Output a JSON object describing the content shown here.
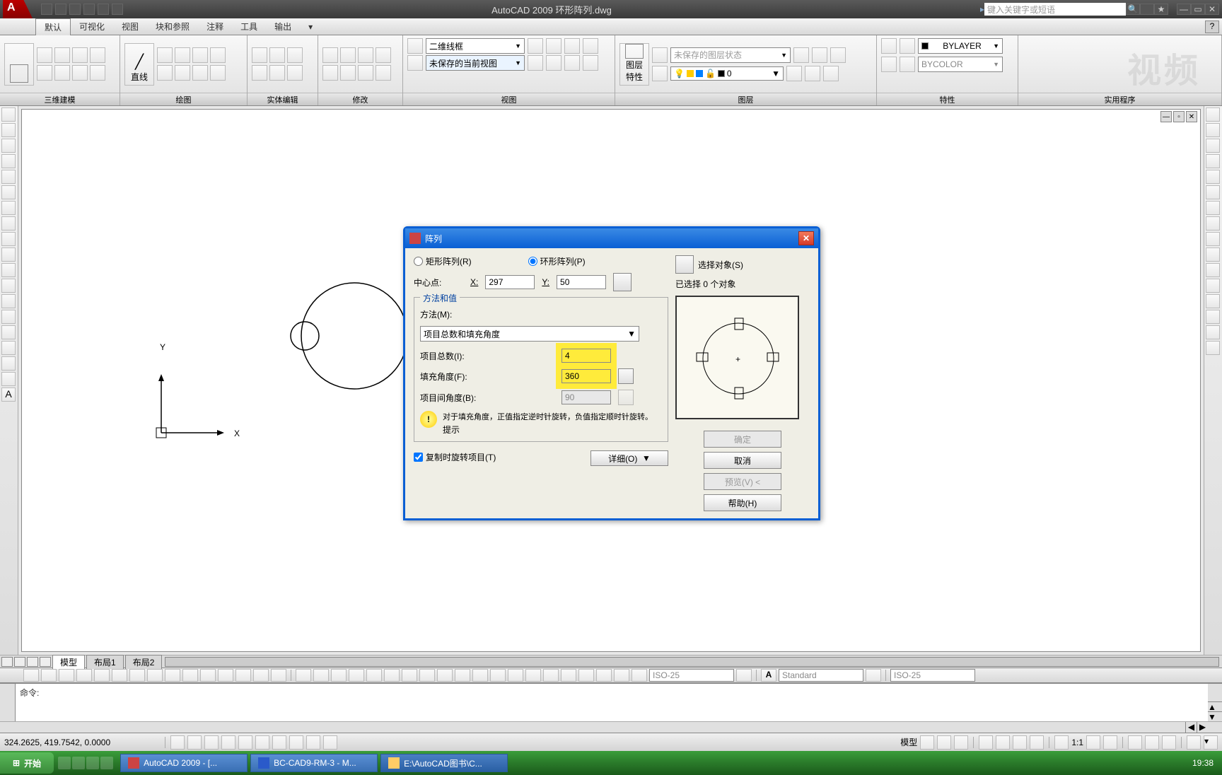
{
  "title": "AutoCAD 2009  环形阵列.dwg",
  "search_placeholder": "键入关键字或短语",
  "menu": {
    "items": [
      "默认",
      "可视化",
      "视图",
      "块和参照",
      "注释",
      "工具",
      "输出"
    ]
  },
  "panels": {
    "p1": "三维建模",
    "p2": "绘图",
    "p3": "实体编辑",
    "p4": "修改",
    "p5": "视图",
    "p6": "图层\n特性",
    "p7": "图层",
    "p8": "特性",
    "p9": "实用程序",
    "line": "直线",
    "visual_style": "二维线框",
    "view_name": "未保存的当前视图",
    "layer_state": "未保存的图层状态",
    "layer_current": "0",
    "bylayer": "BYLAYER",
    "bycolor": "BYCOLOR"
  },
  "tabs": {
    "model": "模型",
    "layout1": "布局1",
    "layout2": "布局2"
  },
  "dimstyle": "ISO-25",
  "textstyle": "Standard",
  "tablestyle": "ISO-25",
  "cmd": "命令:",
  "coords": "324.2625,  419.7542,  0.0000",
  "status": {
    "model": "模型",
    "scale": "1:1"
  },
  "taskbar": {
    "start": "开始",
    "t1": "AutoCAD 2009 - [...",
    "t2": "BC-CAD9-RM-3 - M...",
    "t3": "E:\\AutoCAD图书\\C...",
    "time": "19:38"
  },
  "dialog": {
    "title": "阵列",
    "rect_array": "矩形阵列(R)",
    "polar_array": "环形阵列(P)",
    "select_obj": "选择对象(S)",
    "selected": "已选择 0 个对象",
    "center": "中心点:",
    "x_label": "X:",
    "x_val": "297",
    "y_label": "Y:",
    "y_val": "50",
    "method_group": "方法和值",
    "method_label": "方法(M):",
    "method_value": "项目总数和填充角度",
    "item_count_label": "项目总数(I):",
    "item_count": "4",
    "fill_angle_label": "填充角度(F):",
    "fill_angle": "360",
    "item_angle_label": "项目间角度(B):",
    "item_angle": "90",
    "tip": "对于填充角度，正值指定逆时针旋转，负值指定顺时针旋转。",
    "tip_label": "提示",
    "rotate_copy": "复制时旋转项目(T)",
    "details": "详细(O)",
    "ok": "确定",
    "cancel": "取消",
    "preview": "预览(V) <",
    "help": "帮助(H)"
  },
  "ucs": {
    "x": "X",
    "y": "Y"
  }
}
